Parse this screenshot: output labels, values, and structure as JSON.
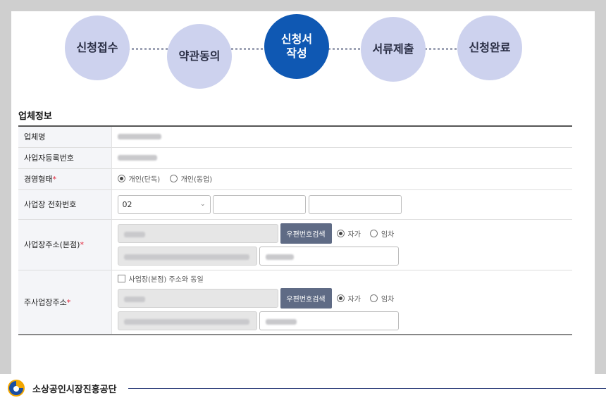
{
  "steps": [
    {
      "label": "신청접수",
      "active": false
    },
    {
      "label": "약관동의",
      "active": false
    },
    {
      "label": "신청서\n작성",
      "active": true
    },
    {
      "label": "서류제출",
      "active": false
    },
    {
      "label": "신청완료",
      "active": false
    }
  ],
  "section": {
    "title": "업체정보"
  },
  "fields": {
    "company_name": {
      "label": "업체명"
    },
    "biz_reg_no": {
      "label": "사업자등록번호"
    },
    "mgmt_type": {
      "label": "경영형태",
      "required_mark": "*",
      "options": [
        "개인(단독)",
        "개인(동업)"
      ],
      "selected": "개인(단독)"
    },
    "phone": {
      "label": "사업장 전화번호",
      "area_code": "02"
    },
    "biz_address": {
      "label": "사업장주소(본점)",
      "required_mark": "*",
      "search_button": "우편번호검색",
      "ownership_options": [
        "자가",
        "임차"
      ],
      "selected": "자가"
    },
    "main_address": {
      "label": "주사업장주소",
      "required_mark": "*",
      "same_as_label": "사업장(본점) 주소와 동일",
      "search_button": "우편번호검색",
      "ownership_options": [
        "자가",
        "임차"
      ],
      "selected": "자가"
    }
  },
  "footer": {
    "org_name": "소상공인시장진흥공단"
  },
  "colors": {
    "active_step": "#0f58b3",
    "step": "#cdd2ee",
    "required": "#e0243a",
    "button": "#5f6b85"
  }
}
